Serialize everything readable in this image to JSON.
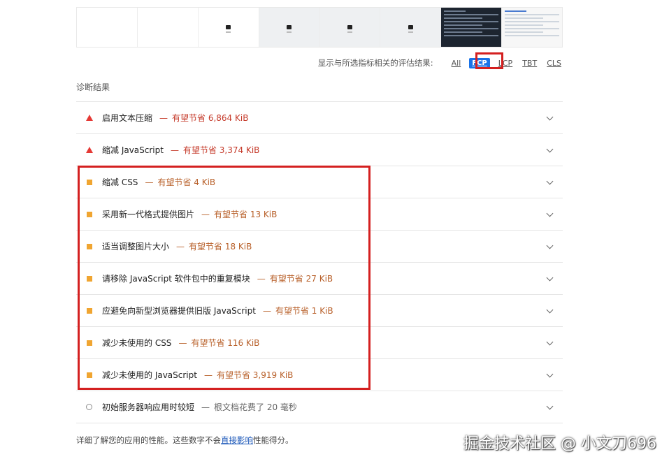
{
  "filter": {
    "label": "显示与所选指标相关的评估结果:",
    "buttons": [
      {
        "label": "All"
      },
      {
        "label": "FCP"
      },
      {
        "label": "LCP"
      },
      {
        "label": "TBT"
      },
      {
        "label": "CLS"
      }
    ],
    "active": "FCP",
    "highlight_color": "#d42020"
  },
  "section_title": "诊断结果",
  "audits": [
    {
      "title": "启用文本压缩",
      "sep": "—",
      "display": "有望节省 6,864 KiB",
      "severity": "fail"
    },
    {
      "title": "缩减 JavaScript",
      "sep": "—",
      "display": "有望节省 3,374 KiB",
      "severity": "fail"
    },
    {
      "title": "缩减 CSS",
      "sep": "—",
      "display": "有望节省 4 KiB",
      "severity": "average"
    },
    {
      "title": "采用新一代格式提供图片",
      "sep": "—",
      "display": "有望节省 13 KiB",
      "severity": "average"
    },
    {
      "title": "适当调整图片大小",
      "sep": "—",
      "display": "有望节省 18 KiB",
      "severity": "average"
    },
    {
      "title": "请移除 JavaScript 软件包中的重复模块",
      "sep": "—",
      "display": "有望节省 27 KiB",
      "severity": "average"
    },
    {
      "title": "应避免向新型浏览器提供旧版 JavaScript",
      "sep": "—",
      "display": "有望节省 1 KiB",
      "severity": "average"
    },
    {
      "title": "减少未使用的 CSS",
      "sep": "—",
      "display": "有望节省 116 KiB",
      "severity": "average"
    },
    {
      "title": "减少未使用的 JavaScript",
      "sep": "—",
      "display": "有望节省 3,919 KiB",
      "severity": "average"
    },
    {
      "title": "初始服务器响应用时较短",
      "sep": "—",
      "display": "根文档花费了 20 毫秒",
      "severity": "info"
    }
  ],
  "footer": {
    "before": "详细了解您的应用的性能。这些数字不会",
    "link": "直接影响",
    "after": "性能得分。"
  },
  "watermark": "掘金技术社区 @ 小文刀696",
  "colors": {
    "fail": "#e53935",
    "average": "#f0a531",
    "accent": "#1a73e8"
  }
}
